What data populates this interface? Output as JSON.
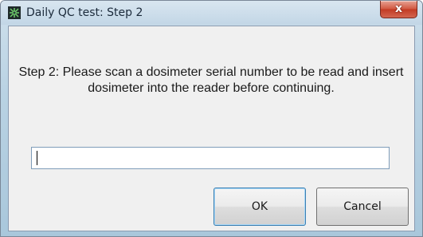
{
  "window": {
    "title": "Daily QC test: Step 2",
    "close_label": "x"
  },
  "dialog": {
    "message": "Step 2: Please scan a dosimeter serial number to be read and insert dosimeter into the reader before continuing.",
    "serial_input": {
      "value": "",
      "placeholder": ""
    },
    "ok_label": "OK",
    "cancel_label": "Cancel"
  },
  "icons": {
    "app": "app-icon",
    "close": "close-icon"
  },
  "colors": {
    "titlebar": "#c2d6e6",
    "client_background": "#f0f0f0",
    "close_button": "#c9452e",
    "default_button_border": "#3c7fb1"
  }
}
